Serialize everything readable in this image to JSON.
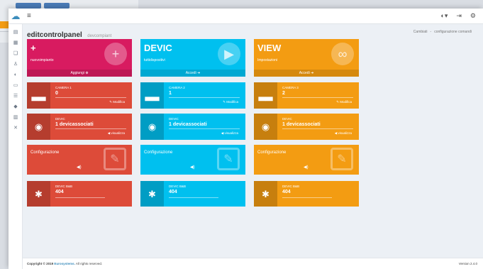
{
  "topbar": {
    "menu_icon": "hamburger-icon"
  },
  "header": {
    "title": "editcontrolpanel",
    "subtitle": "devcompiant"
  },
  "breadcrumbs": [
    "Cambiati",
    "-",
    "configurazione comandi"
  ],
  "sidebar": {
    "icons": [
      "server-icon",
      "building-icon",
      "tags-icon",
      "user-icon",
      "circle-icon",
      "file-icon",
      "list-icon",
      "tag-icon",
      "database-icon",
      "tools-icon"
    ]
  },
  "big_cards": [
    {
      "title": "+",
      "sub": "nuovoimpianto",
      "footer": "Aggiungi",
      "footer_icon": "plus-circle-icon",
      "icon": "plus-icon",
      "color": "#d81b60"
    },
    {
      "title": "DEVIC",
      "sub": "tuttidispositivi",
      "footer": "Accedi",
      "footer_icon": "arrow-circle-icon",
      "icon": "play-icon",
      "color": "#00c0ef"
    },
    {
      "title": "VIEW",
      "sub": "Impostazioni",
      "footer": "Accedi",
      "footer_icon": "arrow-circle-icon",
      "icon": "stumbleupon-icon",
      "color": "#f39c12"
    }
  ],
  "room_cards": [
    {
      "label": "CAMERA 1",
      "value": "0",
      "link": "Modifica",
      "icon": "bed-icon",
      "color": "#dd4b39"
    },
    {
      "label": "CAMERA 2",
      "value": "1",
      "link": "Modifica",
      "icon": "bed-icon",
      "color": "#00c0ef"
    },
    {
      "label": "CAMERA 3",
      "value": "2",
      "link": "Modifica",
      "icon": "bed-icon",
      "color": "#f39c12"
    }
  ],
  "device_cards": [
    {
      "label": "DEVIC",
      "value": "1 devicassociati",
      "link": "visualizza",
      "icon": "rss-icon",
      "color": "#dd4b39"
    },
    {
      "label": "DEVIC",
      "value": "1 devicassociati",
      "link": "visualizza",
      "icon": "rss-icon",
      "color": "#00c0ef"
    },
    {
      "label": "DEVIC",
      "value": "1 devicassociati",
      "link": "visualizza",
      "icon": "rss-icon",
      "color": "#f39c12"
    }
  ],
  "config_cards": [
    {
      "title": "Configurazione",
      "icon": "edit-icon",
      "color": "#dd4b39"
    },
    {
      "title": "Configurazione",
      "icon": "edit-icon",
      "color": "#00c0ef"
    },
    {
      "title": "Configurazione",
      "icon": "edit-icon",
      "color": "#f39c12"
    }
  ],
  "bug_cards": [
    {
      "label": "DEVIC B&B",
      "value": "404",
      "icon": "bug-icon",
      "color": "#dd4b39"
    },
    {
      "label": "DEVIC B&B",
      "value": "404",
      "icon": "bug-icon",
      "color": "#00c0ef"
    },
    {
      "label": "DEVIC B&B",
      "value": "404",
      "icon": "bug-icon",
      "color": "#f39c12"
    }
  ],
  "footer": {
    "copyright": "Copyright © 2019",
    "brand": "Eurosystems.",
    "rights": "All rights reserved.",
    "version": "Version 2.4.0"
  }
}
